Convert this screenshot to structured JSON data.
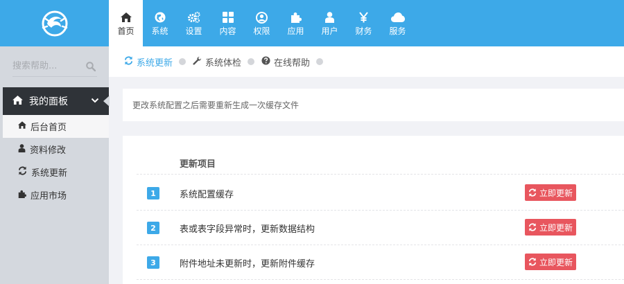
{
  "nav": [
    {
      "label": "首页",
      "icon": "home-icon"
    },
    {
      "label": "系统",
      "icon": "globe-icon"
    },
    {
      "label": "设置",
      "icon": "gears-icon"
    },
    {
      "label": "内容",
      "icon": "grid-icon"
    },
    {
      "label": "权限",
      "icon": "user-circle-icon"
    },
    {
      "label": "应用",
      "icon": "puzzle-icon"
    },
    {
      "label": "用户",
      "icon": "user-icon"
    },
    {
      "label": "财务",
      "icon": "yen-icon"
    },
    {
      "label": "服务",
      "icon": "cloud-icon"
    }
  ],
  "sidebar": {
    "search_placeholder": "搜索帮助...",
    "panel_title": "我的面板",
    "items": [
      {
        "label": "后台首页",
        "icon": "home-icon"
      },
      {
        "label": "资料修改",
        "icon": "user-icon"
      },
      {
        "label": "系统更新",
        "icon": "refresh-icon"
      },
      {
        "label": "应用市场",
        "icon": "puzzle-icon"
      }
    ]
  },
  "tabs": [
    {
      "label": "系统更新",
      "icon": "refresh-icon"
    },
    {
      "label": "系统体检",
      "icon": "wrench-icon"
    },
    {
      "label": "在线帮助",
      "icon": "question-icon"
    }
  ],
  "notice": "更改系统配置之后需要重新生成一次缓存文件",
  "table": {
    "header": "更新项目",
    "rows": [
      {
        "num": "1",
        "text": "系统配置缓存",
        "button": "立即更新"
      },
      {
        "num": "2",
        "text": "表或表字段异常时，更新数据结构",
        "button": "立即更新"
      },
      {
        "num": "3",
        "text": "附件地址未更新时，更新附件缓存",
        "button": "立即更新"
      }
    ]
  },
  "colors": {
    "topbar": "#3da9e8",
    "sidebar": "#d4d8de",
    "panel_header": "#2f3338",
    "update_button": "#e8565e"
  }
}
